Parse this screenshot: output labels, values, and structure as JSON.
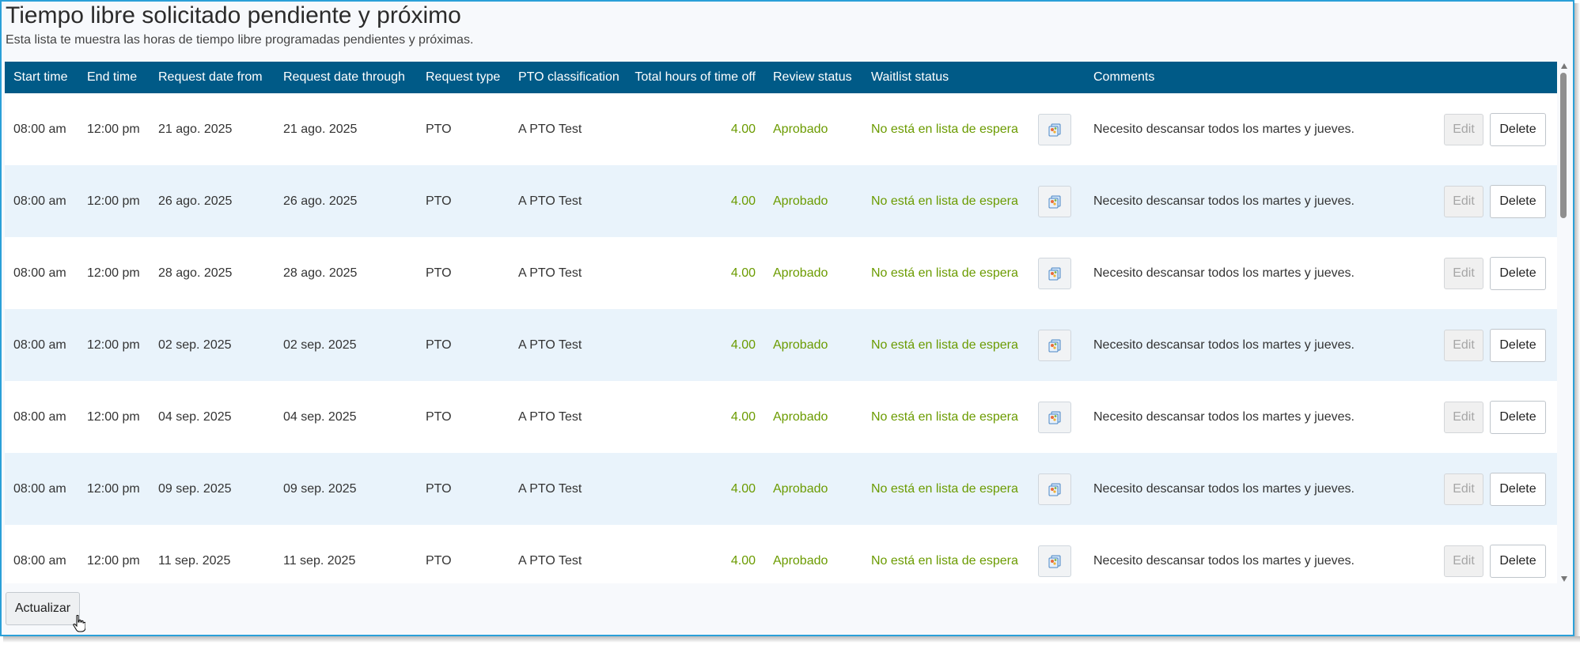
{
  "page": {
    "title": "Tiempo libre solicitado pendiente y próximo",
    "subtitle": "Esta lista te muestra las horas de tiempo libre programadas pendientes y próximas."
  },
  "table": {
    "columns": [
      "Start time",
      "End time",
      "Request date from",
      "Request date through",
      "Request type",
      "PTO classification",
      "Total hours of time off",
      "Review status",
      "Waitlist status",
      "",
      "Comments",
      ""
    ],
    "rows": [
      {
        "start": "08:00 am",
        "end": "12:00 pm",
        "from": "21 ago. 2025",
        "through": "21 ago. 2025",
        "type": "PTO",
        "classification": "A PTO Test",
        "hours": "4.00",
        "review": "Aprobado",
        "waitlist": "No está en lista de espera",
        "comments": "Necesito descansar todos los martes y jueves.",
        "edit": "Edit",
        "delete": "Delete"
      },
      {
        "start": "08:00 am",
        "end": "12:00 pm",
        "from": "26 ago. 2025",
        "through": "26 ago. 2025",
        "type": "PTO",
        "classification": "A PTO Test",
        "hours": "4.00",
        "review": "Aprobado",
        "waitlist": "No está en lista de espera",
        "comments": "Necesito descansar todos los martes y jueves.",
        "edit": "Edit",
        "delete": "Delete"
      },
      {
        "start": "08:00 am",
        "end": "12:00 pm",
        "from": "28 ago. 2025",
        "through": "28 ago. 2025",
        "type": "PTO",
        "classification": "A PTO Test",
        "hours": "4.00",
        "review": "Aprobado",
        "waitlist": "No está en lista de espera",
        "comments": "Necesito descansar todos los martes y jueves.",
        "edit": "Edit",
        "delete": "Delete"
      },
      {
        "start": "08:00 am",
        "end": "12:00 pm",
        "from": "02 sep. 2025",
        "through": "02 sep. 2025",
        "type": "PTO",
        "classification": "A PTO Test",
        "hours": "4.00",
        "review": "Aprobado",
        "waitlist": "No está en lista de espera",
        "comments": "Necesito descansar todos los martes y jueves.",
        "edit": "Edit",
        "delete": "Delete"
      },
      {
        "start": "08:00 am",
        "end": "12:00 pm",
        "from": "04 sep. 2025",
        "through": "04 sep. 2025",
        "type": "PTO",
        "classification": "A PTO Test",
        "hours": "4.00",
        "review": "Aprobado",
        "waitlist": "No está en lista de espera",
        "comments": "Necesito descansar todos los martes y jueves.",
        "edit": "Edit",
        "delete": "Delete"
      },
      {
        "start": "08:00 am",
        "end": "12:00 pm",
        "from": "09 sep. 2025",
        "through": "09 sep. 2025",
        "type": "PTO",
        "classification": "A PTO Test",
        "hours": "4.00",
        "review": "Aprobado",
        "waitlist": "No está en lista de espera",
        "comments": "Necesito descansar todos los martes y jueves.",
        "edit": "Edit",
        "delete": "Delete"
      },
      {
        "start": "08:00 am",
        "end": "12:00 pm",
        "from": "11 sep. 2025",
        "through": "11 sep. 2025",
        "type": "PTO",
        "classification": "A PTO Test",
        "hours": "4.00",
        "review": "Aprobado",
        "waitlist": "No está en lista de espera",
        "comments": "Necesito descansar todos los martes y jueves.",
        "edit": "Edit",
        "delete": "Delete"
      }
    ]
  },
  "footer": {
    "refresh_label": "Actualizar"
  },
  "colors": {
    "header_bg": "#005a87",
    "status_green": "#6b9b00",
    "row_alt": "#e9f3fb",
    "border_accent": "#2aa0d8"
  },
  "icons": {
    "notes": "notes-icon",
    "cursor": "hand-cursor-icon"
  }
}
